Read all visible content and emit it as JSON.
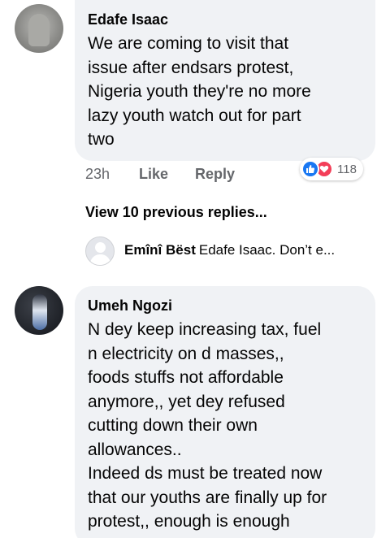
{
  "comments": [
    {
      "author": "Edafe Isaac",
      "text": "We are coming to visit that\nissue after endsars protest,\nNigeria youth they're no more\nlazy youth watch out for part\ntwo",
      "time": "23h",
      "like_label": "Like",
      "reply_label": "Reply",
      "reactions": {
        "icons": [
          "like-icon",
          "love-icon"
        ],
        "count": "118"
      },
      "view_replies": "View 10 previous replies...",
      "reply_preview": {
        "author": "Emînî Bëst",
        "text": "Edafe Isaac. Don’t e..."
      }
    },
    {
      "author": "Umeh Ngozi",
      "text": "N dey keep increasing tax, fuel\nn electricity on d masses,,\nfoods stuffs not affordable\nanymore,, yet dey refused\ncutting down their own\nallowances..\nIndeed ds must be treated now\nthat our youths are finally up for\nprotest,, enough is enough"
    }
  ],
  "colors": {
    "bubble": "#f0f2f5",
    "secondary_text": "#65676b",
    "like_blue": "#1877f2",
    "love_red": "#f33e58"
  }
}
